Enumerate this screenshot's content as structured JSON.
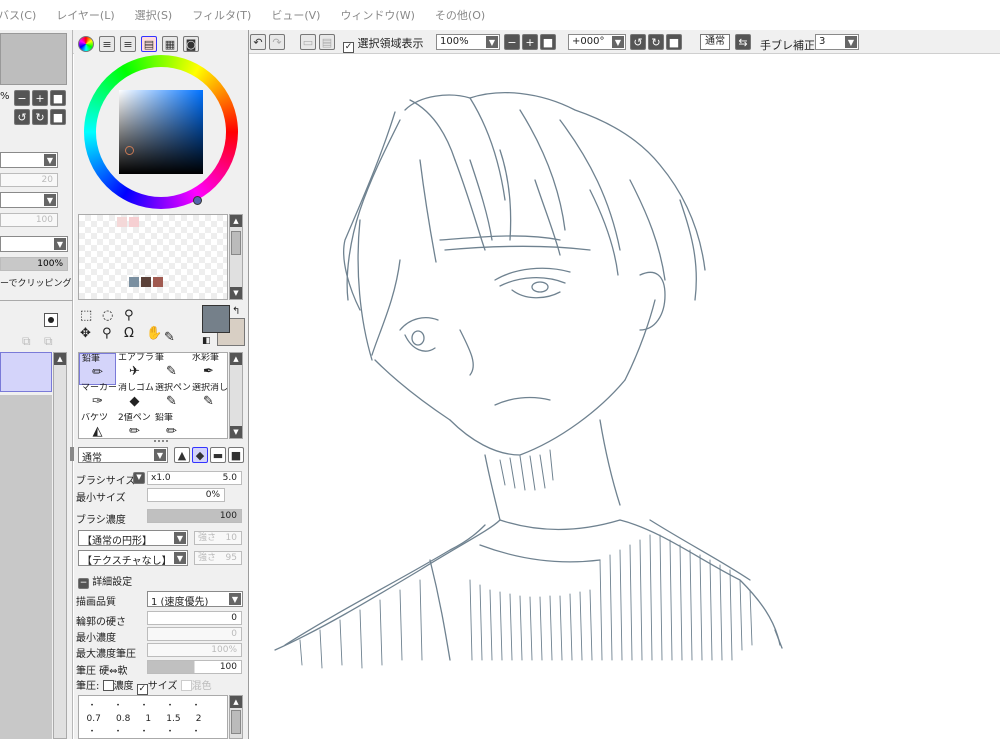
{
  "menu": [
    "バス(C)",
    "レイヤー(L)",
    "選択(S)",
    "フィルタ(T)",
    "ビュー(V)",
    "ウィンドウ(W)",
    "その他(O)"
  ],
  "toolbar": {
    "show_selection_label": "選択領域表示",
    "show_selection_checked": true,
    "zoom": "100%",
    "rotation": "+000°",
    "blend_mode": "通常",
    "stabilizer_label": "手ブレ補正",
    "stabilizer_value": "3"
  },
  "left_panel": {
    "pct_label": "%",
    "field1": "20",
    "field2": "100",
    "opacity": "100%",
    "clipping_label": "ーでクリッピング"
  },
  "color": {
    "cursor_color": "#c87a55",
    "swatches": [
      "#7a8fa0",
      "#5a4038",
      "#a05a50"
    ],
    "top_swatches": [
      "#f4d8d8",
      "#f6cfd2"
    ],
    "primary": "#75808a",
    "secondary": "#d8cfc4"
  },
  "tools": [
    {
      "name": "鉛筆",
      "icon": "✏"
    },
    {
      "name": "エアブラシ",
      "icon": "✈"
    },
    {
      "name": "筆",
      "icon": "✎"
    },
    {
      "name": "水彩筆",
      "icon": "✒"
    },
    {
      "name": "マーカー",
      "icon": "✑"
    },
    {
      "name": "消しゴム",
      "icon": "◆"
    },
    {
      "name": "選択ペン",
      "icon": "✎"
    },
    {
      "name": "選択消し",
      "icon": "✎"
    },
    {
      "name": "バケツ",
      "icon": "◭"
    },
    {
      "name": "2値ペン",
      "icon": "✏"
    },
    {
      "name": "鉛筆",
      "icon": "✏"
    }
  ],
  "brush": {
    "mode": "通常",
    "size_label": "ブラシサイズ",
    "size_mult": "x1.0",
    "size_value": "5.0",
    "min_size_label": "最小サイズ",
    "min_size_value": "0%",
    "density_label": "ブラシ濃度",
    "density_value": "100",
    "shape": "【通常の円形】",
    "shape_strength_label": "強さ",
    "shape_strength": "10",
    "texture": "【テクスチャなし】",
    "texture_strength_label": "強さ",
    "texture_strength": "95",
    "detail_label": "詳細設定",
    "quality_label": "描画品質",
    "quality_value": "1 (速度優先)",
    "edge_label": "輪郭の硬さ",
    "edge_value": "0",
    "min_density_label": "最小濃度",
    "min_density_value": "0",
    "max_density_label": "最大濃度筆圧",
    "max_density_value": "100%",
    "pressure_label": "筆圧 硬⇔軟",
    "pressure_value": "100",
    "pen_label": "筆圧:",
    "pen_density": "濃度",
    "pen_size": "サイズ",
    "pen_blend": "混色",
    "pen_density_checked": false,
    "pen_size_checked": true,
    "pen_blend_checked": false
  },
  "brush_sizes": [
    "0.7",
    "0.8",
    "1",
    "1.5",
    "2"
  ]
}
